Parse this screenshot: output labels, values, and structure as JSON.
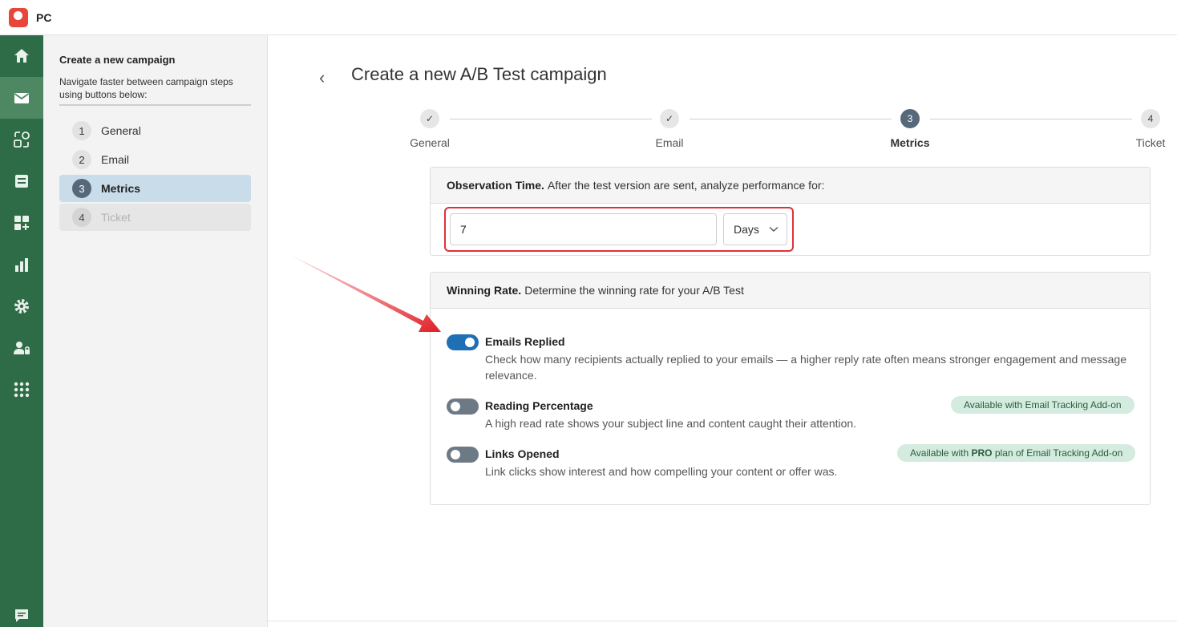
{
  "app": {
    "title": "PC"
  },
  "rail": {
    "items": [
      {
        "icon": "home-icon"
      },
      {
        "icon": "mail-icon",
        "active": true
      },
      {
        "icon": "automation-icon"
      },
      {
        "icon": "inbox-icon"
      },
      {
        "icon": "add-widget-icon"
      },
      {
        "icon": "bar-chart-icon"
      },
      {
        "icon": "gear-icon"
      },
      {
        "icon": "user-lock-icon"
      },
      {
        "icon": "apps-grid-icon"
      },
      {
        "icon": "chat-icon"
      }
    ]
  },
  "sidebar": {
    "title": "Create a new campaign",
    "description": "Navigate faster between campaign steps using buttons below:",
    "steps": [
      {
        "num": "1",
        "label": "General"
      },
      {
        "num": "2",
        "label": "Email"
      },
      {
        "num": "3",
        "label": "Metrics"
      },
      {
        "num": "4",
        "label": "Ticket"
      }
    ]
  },
  "main": {
    "back_label": "‹",
    "title": "Create a new A/B Test campaign",
    "progress": [
      {
        "mark": "✓",
        "label": "General"
      },
      {
        "mark": "✓",
        "label": "Email"
      },
      {
        "mark": "3",
        "label": "Metrics"
      },
      {
        "mark": "4",
        "label": "Ticket"
      }
    ],
    "observation": {
      "heading_bold": "Observation Time.",
      "heading_text": "After the test version are sent, analyze performance for:",
      "value": "7",
      "unit": "Days"
    },
    "winning": {
      "heading_bold": "Winning Rate.",
      "heading_text": "Determine the winning rate for your A/B Test",
      "metrics": [
        {
          "title": "Emails Replied",
          "description": "Check how many recipients actually replied to your emails — a higher reply rate often means stronger engagement and message relevance.",
          "enabled": true,
          "badge": ""
        },
        {
          "title": "Reading Percentage",
          "description": "A high read rate shows your subject line and content caught their attention.",
          "enabled": false,
          "badge": "Available with Email Tracking Add-on"
        },
        {
          "title": "Links Opened",
          "description": "Link clicks show interest and how compelling your content or offer was.",
          "enabled": false,
          "badge_pre": "Available with ",
          "badge_bold": "PRO",
          "badge_post": " plan of Email Tracking Add-on"
        }
      ]
    }
  },
  "colors": {
    "rail": "#2e6b47",
    "rail_active": "#4d8862",
    "toggle_on": "#1f6fb5",
    "badge_bg": "#d4ebdf",
    "highlight": "#e0303a"
  }
}
